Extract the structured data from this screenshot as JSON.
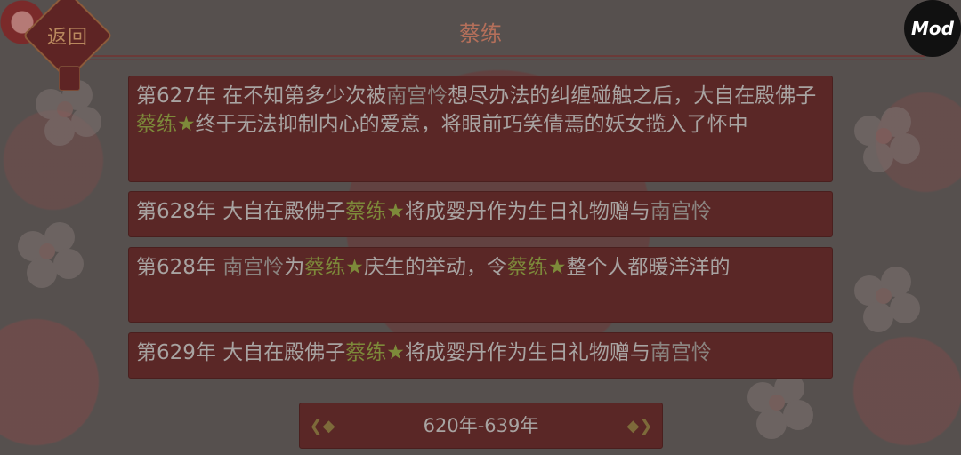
{
  "header": {
    "back_label": "返回",
    "title": "蔡练",
    "mod_badge": "Mod"
  },
  "events": [
    {
      "year": "第627年",
      "segments": [
        {
          "text": "在不知第多少次被",
          "kind": "plain"
        },
        {
          "text": "南宫怜",
          "kind": "name"
        },
        {
          "text": "想尽办法的纠缠碰触之后，大自在殿佛子",
          "kind": "plain"
        },
        {
          "text": "蔡练",
          "kind": "self"
        },
        {
          "text": "★",
          "kind": "star"
        },
        {
          "text": "终于无法抑制内心的爱意，将眼前巧笑倩焉的妖女揽入了怀中",
          "kind": "plain"
        }
      ]
    },
    {
      "year": "第628年",
      "segments": [
        {
          "text": "大自在殿佛子",
          "kind": "plain"
        },
        {
          "text": "蔡练",
          "kind": "self"
        },
        {
          "text": "★",
          "kind": "star"
        },
        {
          "text": "将成婴丹作为生日礼物赠与",
          "kind": "plain"
        },
        {
          "text": "南宫怜",
          "kind": "name"
        }
      ]
    },
    {
      "year": "第628年",
      "segments": [
        {
          "text": "南宫怜",
          "kind": "name"
        },
        {
          "text": "为",
          "kind": "plain"
        },
        {
          "text": "蔡练",
          "kind": "self"
        },
        {
          "text": "★",
          "kind": "star"
        },
        {
          "text": "庆生的举动，令",
          "kind": "plain"
        },
        {
          "text": "蔡练",
          "kind": "self"
        },
        {
          "text": "★",
          "kind": "star"
        },
        {
          "text": "整个人都暖洋洋的",
          "kind": "plain"
        }
      ]
    },
    {
      "year": "第629年",
      "segments": [
        {
          "text": "大自在殿佛子",
          "kind": "plain"
        },
        {
          "text": "蔡练",
          "kind": "self"
        },
        {
          "text": "★",
          "kind": "star"
        },
        {
          "text": "将成婴丹作为生日礼物赠与",
          "kind": "plain"
        },
        {
          "text": "南宫怜",
          "kind": "name"
        }
      ]
    }
  ],
  "range_selector": {
    "label": "620年-639年"
  },
  "colors": {
    "name_highlight": "#8b8480",
    "self_highlight": "#7d8a3a",
    "card_bg": "#5a2726",
    "body_text": "#a8a3a1"
  }
}
